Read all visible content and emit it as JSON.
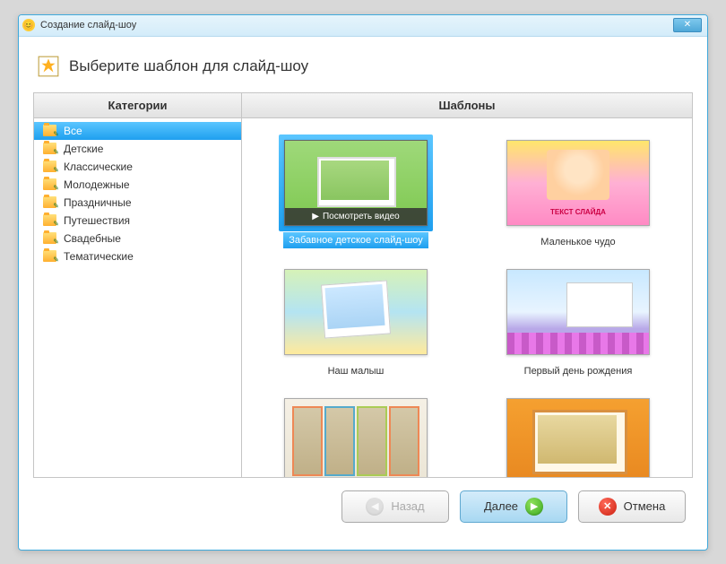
{
  "window": {
    "title": "Создание слайд-шоу"
  },
  "header": {
    "title": "Выберите шаблон для слайд-шоу"
  },
  "sidebar": {
    "header": "Категории",
    "items": [
      {
        "label": "Все",
        "selected": true
      },
      {
        "label": "Детские",
        "selected": false
      },
      {
        "label": "Классические",
        "selected": false
      },
      {
        "label": "Молодежные",
        "selected": false
      },
      {
        "label": "Праздничные",
        "selected": false
      },
      {
        "label": "Путешествия",
        "selected": false
      },
      {
        "label": "Свадебные",
        "selected": false
      },
      {
        "label": "Тематические",
        "selected": false
      }
    ]
  },
  "templates": {
    "header": "Шаблоны",
    "watch_video_label": "Посмотреть видео",
    "items": [
      {
        "label": "Забавное детское слайд-шоу",
        "selected": true
      },
      {
        "label": "Маленькое чудо",
        "selected": false,
        "overlay_text": "ТЕКСТ СЛАЙДА"
      },
      {
        "label": "Наш малыш",
        "selected": false
      },
      {
        "label": "Первый день рождения",
        "selected": false
      },
      {
        "label": "",
        "selected": false
      },
      {
        "label": "",
        "selected": false
      }
    ]
  },
  "buttons": {
    "back": "Назад",
    "next": "Далее",
    "cancel": "Отмена"
  }
}
